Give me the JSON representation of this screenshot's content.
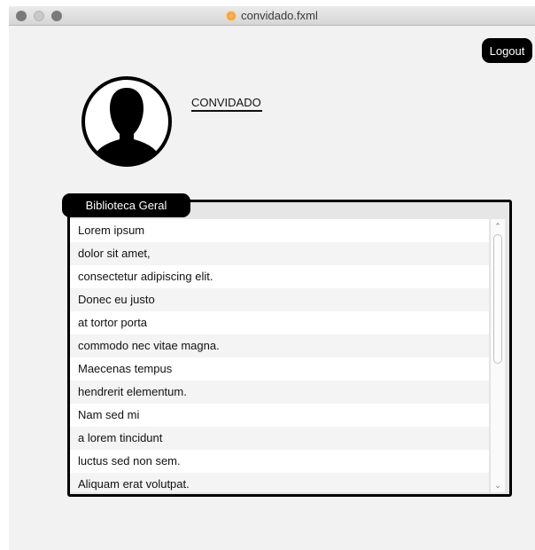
{
  "window": {
    "title": "convidado.fxml"
  },
  "header": {
    "logout_label": "Logout"
  },
  "profile": {
    "role_label": "CONVIDADO"
  },
  "library": {
    "tab_label": "Biblioteca Geral",
    "items": [
      "Lorem ipsum",
      "dolor sit amet,",
      "consectetur adipiscing elit.",
      "Donec eu justo",
      "at tortor porta",
      "commodo nec vitae magna.",
      "Maecenas tempus",
      "hendrerit elementum.",
      "Nam sed mi",
      "a lorem tincidunt",
      "luctus sed non sem.",
      "Aliquam erat volutpat."
    ]
  },
  "icons": {
    "avatar": "user-silhouette-icon",
    "doc": "fxml-document-icon",
    "scroll_up": "chevron-up-icon",
    "scroll_down": "chevron-down-icon"
  }
}
